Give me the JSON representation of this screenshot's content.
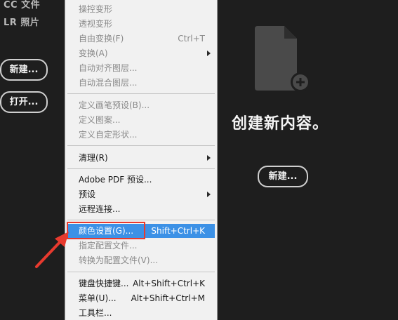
{
  "left": {
    "links": [
      "CC 文件",
      "LR 照片"
    ],
    "new_button": "新建...",
    "open_button": "打开..."
  },
  "welcome": {
    "title": "创建新内容。",
    "new_button": "新建..."
  },
  "menu": {
    "items": [
      {
        "label": "操控变形",
        "disabled": true
      },
      {
        "label": "透视变形",
        "disabled": true
      },
      {
        "label": "自由变换(F)",
        "shortcut": "Ctrl+T",
        "disabled": true
      },
      {
        "label": "变换(A)",
        "disabled": true,
        "submenu": true
      },
      {
        "label": "自动对齐图层...",
        "disabled": true
      },
      {
        "label": "自动混合图层...",
        "disabled": true
      },
      {
        "label": "定义画笔预设(B)...",
        "disabled": true
      },
      {
        "label": "定义图案...",
        "disabled": true
      },
      {
        "label": "定义自定形状...",
        "disabled": true
      },
      {
        "label": "清理(R)",
        "submenu": true
      },
      {
        "label": "Adobe PDF 预设..."
      },
      {
        "label": "预设",
        "submenu": true
      },
      {
        "label": "远程连接..."
      },
      {
        "label": "颜色设置(G)...",
        "shortcut": "Shift+Ctrl+K",
        "highlighted": true
      },
      {
        "label": "指定配置文件...",
        "disabled": true
      },
      {
        "label": "转换为配置文件(V)...",
        "disabled": true
      },
      {
        "label": "键盘快捷键...",
        "shortcut": "Alt+Shift+Ctrl+K"
      },
      {
        "label": "菜单(U)...",
        "shortcut": "Alt+Shift+Ctrl+M"
      },
      {
        "label": "工具栏..."
      }
    ]
  },
  "colors": {
    "highlight": "#3c91e6",
    "annotation": "#e83a2e"
  },
  "icons": [
    "new-document-icon",
    "add-circle-icon",
    "submenu-arrow-icon",
    "annotation-arrow-icon"
  ]
}
